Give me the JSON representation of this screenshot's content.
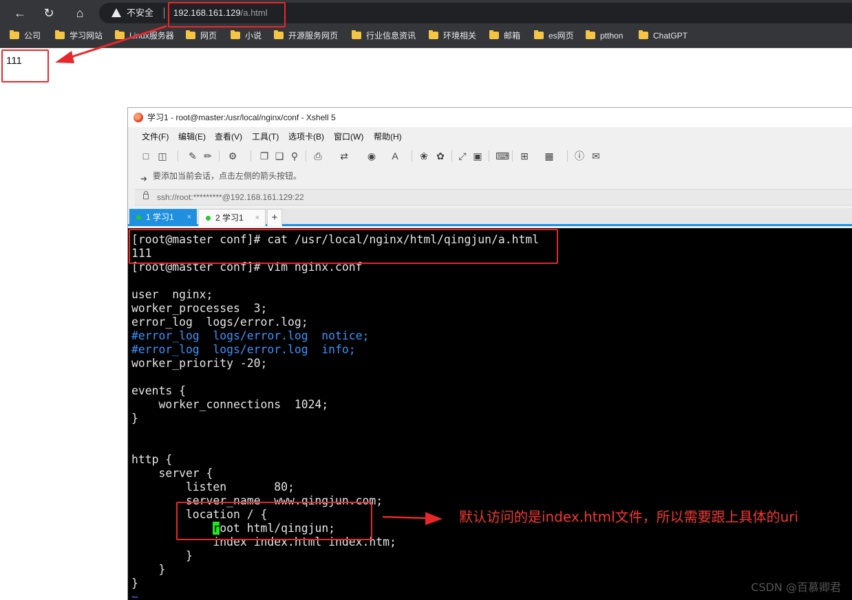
{
  "browser": {
    "security_label": "不安全",
    "url_host": "192.168.161.129",
    "url_path": "/a.html",
    "bookmarks": [
      "公司",
      "学习网站",
      "Linux服务器",
      "网页",
      "小说",
      "开源服务网页",
      "行业信息资讯",
      "环境相关",
      "邮箱",
      "es网页",
      "ptthon",
      "ChatGPT"
    ],
    "page_content": "111"
  },
  "xshell": {
    "title": "学习1 - root@master:/usr/local/nginx/conf - Xshell 5",
    "menu": [
      "文件(F)",
      "编辑(E)",
      "查看(V)",
      "工具(T)",
      "选项卡(B)",
      "窗口(W)",
      "帮助(H)"
    ],
    "hint": "要添加当前会话，点击左侧的箭头按钮。",
    "address": "ssh://root:*********@192.168.161.129:22",
    "tabs": [
      {
        "label": "1 学习1",
        "active": true
      },
      {
        "label": "2 学习1",
        "active": false
      }
    ],
    "terminal_lines": [
      {
        "text": "[root@master conf]# cat /usr/local/nginx/html/qingjun/a.html",
        "kind": "normal"
      },
      {
        "text": "111",
        "kind": "normal"
      },
      {
        "text": "[root@master conf]# vim nginx.conf",
        "kind": "normal"
      },
      {
        "text": "",
        "kind": "normal"
      },
      {
        "text": "user  nginx;",
        "kind": "normal"
      },
      {
        "text": "worker_processes  3;",
        "kind": "normal"
      },
      {
        "text": "error_log  logs/error.log;",
        "kind": "normal"
      },
      {
        "text": "#error_log  logs/error.log  notice;",
        "kind": "comment"
      },
      {
        "text": "#error_log  logs/error.log  info;",
        "kind": "comment"
      },
      {
        "text": "worker_priority -20;",
        "kind": "normal"
      },
      {
        "text": "",
        "kind": "normal"
      },
      {
        "text": "events {",
        "kind": "normal"
      },
      {
        "text": "    worker_connections  1024;",
        "kind": "normal"
      },
      {
        "text": "}",
        "kind": "normal"
      },
      {
        "text": "",
        "kind": "normal"
      },
      {
        "text": "",
        "kind": "normal"
      },
      {
        "text": "http {",
        "kind": "normal"
      },
      {
        "text": "    server {",
        "kind": "normal"
      },
      {
        "text": "        listen       80;",
        "kind": "normal"
      },
      {
        "text": "        server_name  www.qingjun.com;",
        "kind": "normal"
      },
      {
        "text": "        location / {",
        "kind": "normal"
      },
      {
        "text": "            root html/qingjun;",
        "kind": "cursor"
      },
      {
        "text": "            index index.html index.htm;",
        "kind": "normal"
      },
      {
        "text": "        }",
        "kind": "normal"
      },
      {
        "text": "    }",
        "kind": "normal"
      },
      {
        "text": "}",
        "kind": "normal"
      },
      {
        "text": "~",
        "kind": "tilde"
      }
    ]
  },
  "annotation": {
    "note": "默认访问的是index.html文件，所以需要跟上具体的uri",
    "color": "#e8272b"
  },
  "watermark": "CSDN @百慕卿君"
}
